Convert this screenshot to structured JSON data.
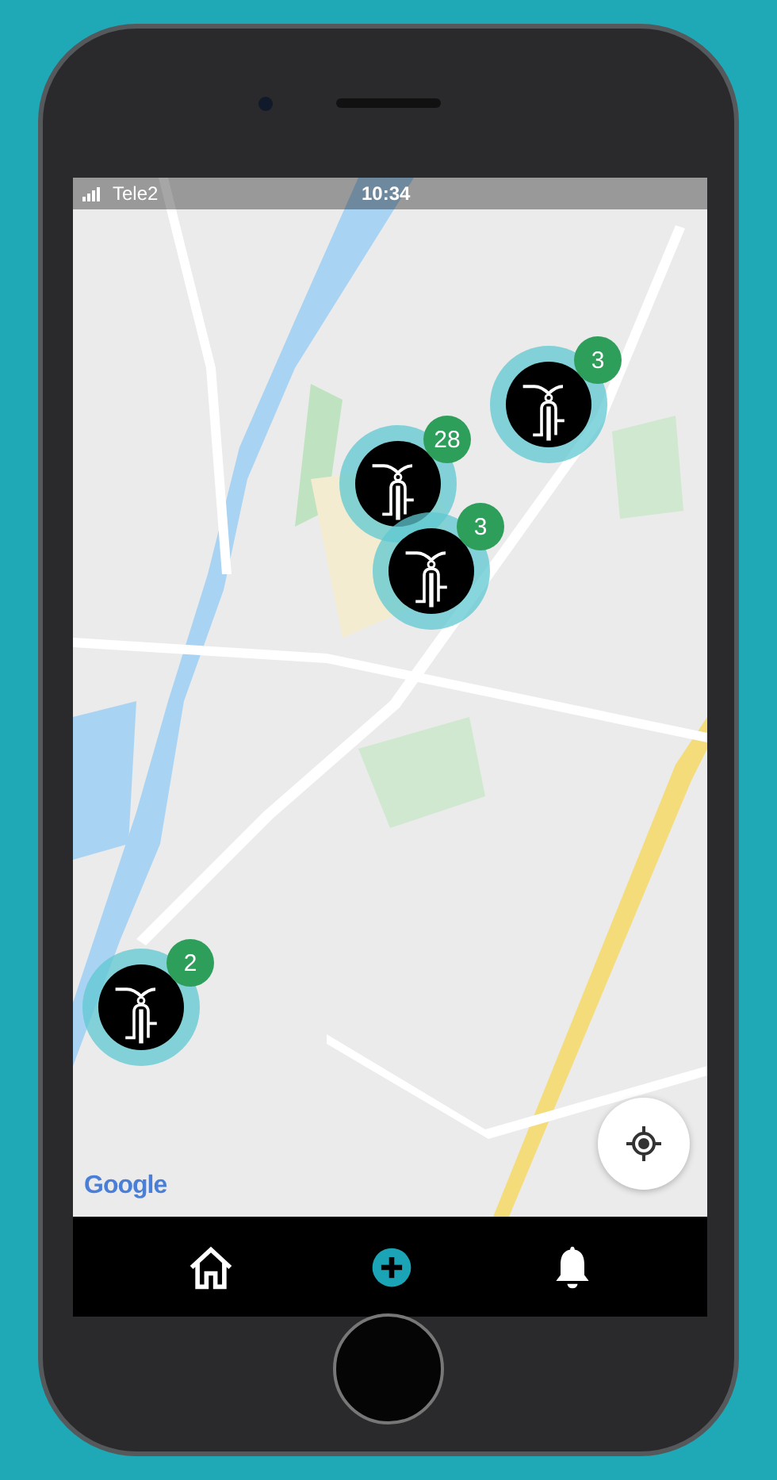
{
  "status_bar": {
    "carrier": "Tele2",
    "time": "10:34"
  },
  "map": {
    "kind": "picture",
    "attribution": "Google",
    "clusters": [
      {
        "count": "3"
      },
      {
        "count": "28"
      },
      {
        "count": "3"
      },
      {
        "count": "2"
      }
    ]
  },
  "nav": [
    {
      "kind": "home"
    },
    {
      "kind": "add"
    },
    {
      "kind": "bell"
    }
  ]
}
